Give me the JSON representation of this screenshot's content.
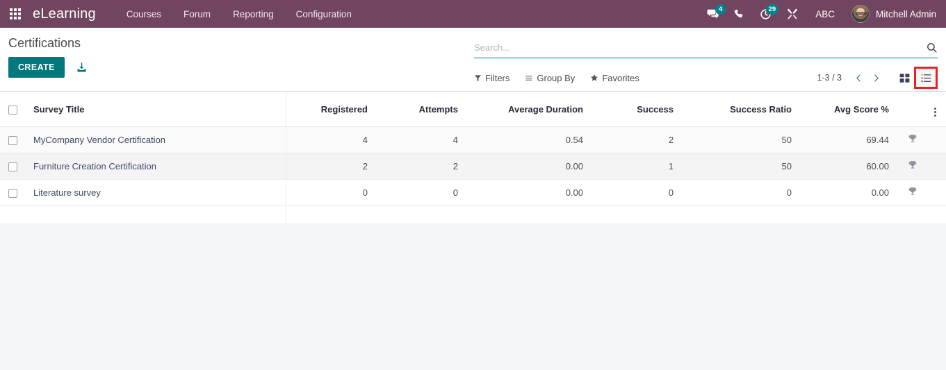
{
  "navbar": {
    "apps_icon": "apps-grid-icon",
    "brand": "eLearning",
    "menu": [
      {
        "label": "Courses"
      },
      {
        "label": "Forum"
      },
      {
        "label": "Reporting"
      },
      {
        "label": "Configuration"
      }
    ],
    "messages_icon": "messages-icon",
    "messages_count": "4",
    "phone_icon": "phone-icon",
    "activities_icon": "activities-clock-icon",
    "activities_count": "29",
    "tools_icon": "wrench-tools-icon",
    "abc_label": "ABC",
    "user_name": "Mitchell Admin",
    "background_color": "#71445f",
    "badge_color": "#00838f"
  },
  "control_panel": {
    "title": "Certifications",
    "create_label": "CREATE",
    "import_icon": "import-download-icon",
    "search": {
      "placeholder": "Search...",
      "value": "",
      "search_icon": "search-icon"
    },
    "filters_label": "Filters",
    "filters_icon": "filter-funnel-icon",
    "group_by_label": "Group By",
    "group_by_icon": "group-by-bars-icon",
    "favorites_label": "Favorites",
    "favorites_icon": "star-icon",
    "pager": "1-3 / 3",
    "prev_icon": "chevron-left-icon",
    "next_icon": "chevron-right-icon",
    "view_kanban_icon": "kanban-view-icon",
    "view_list_icon": "list-view-icon",
    "active_view": "list",
    "highlight_color": "#ef2020",
    "accent_color": "#00787d"
  },
  "table": {
    "select_all_icon": "checkbox-unchecked-icon",
    "optional_columns_icon": "vertical-dots-icon",
    "columns": [
      "Survey Title",
      "Registered",
      "Attempts",
      "Average Duration",
      "Success",
      "Success Ratio",
      "Avg Score %"
    ],
    "rows": [
      {
        "title": "MyCompany Vendor Certification",
        "registered": "4",
        "attempts": "4",
        "average_duration": "0.54",
        "success": "2",
        "success_ratio": "50",
        "avg_score": "69.44",
        "trophy_icon": "trophy-icon"
      },
      {
        "title": "Furniture Creation Certification",
        "registered": "2",
        "attempts": "2",
        "average_duration": "0.00",
        "success": "1",
        "success_ratio": "50",
        "avg_score": "60.00",
        "trophy_icon": "trophy-icon"
      },
      {
        "title": "Literature survey",
        "registered": "0",
        "attempts": "0",
        "average_duration": "0.00",
        "success": "0",
        "success_ratio": "0",
        "avg_score": "0.00",
        "trophy_icon": "trophy-icon"
      }
    ]
  }
}
